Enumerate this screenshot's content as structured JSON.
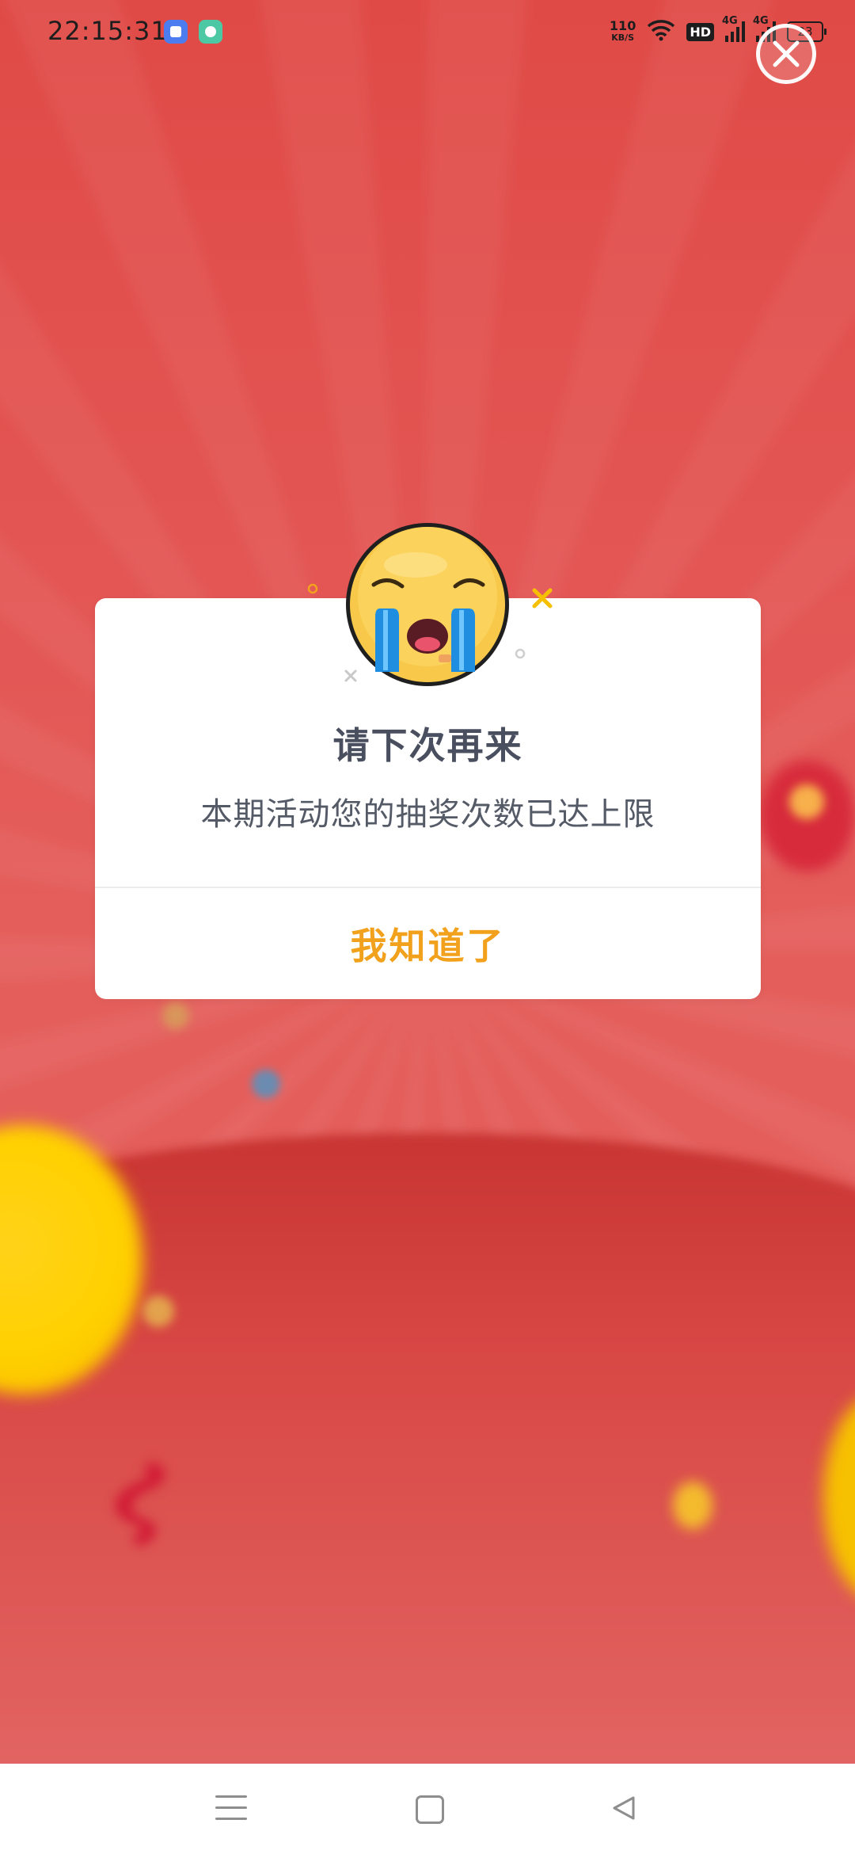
{
  "status_bar": {
    "time": "22:15:31",
    "network_speed_value": "110",
    "network_speed_unit": "KB/S",
    "hd_label": "HD",
    "signal1_label": "4G",
    "signal2_label": "4G",
    "battery": "23",
    "app_icons": [
      "blue-app-icon",
      "green-app-icon"
    ]
  },
  "close_button": {
    "icon": "close-icon"
  },
  "dialog": {
    "icon": "crying-face-icon",
    "title": "请下次再来",
    "message": "本期活动您的抽奖次数已达上限",
    "confirm_label": "我知道了"
  },
  "nav_bar": {
    "items": [
      "menu-icon",
      "home-icon",
      "back-icon"
    ]
  },
  "colors": {
    "background_red": "#e35755",
    "confirm_orange": "#f2a11c",
    "title_text": "#4a4f5f"
  }
}
